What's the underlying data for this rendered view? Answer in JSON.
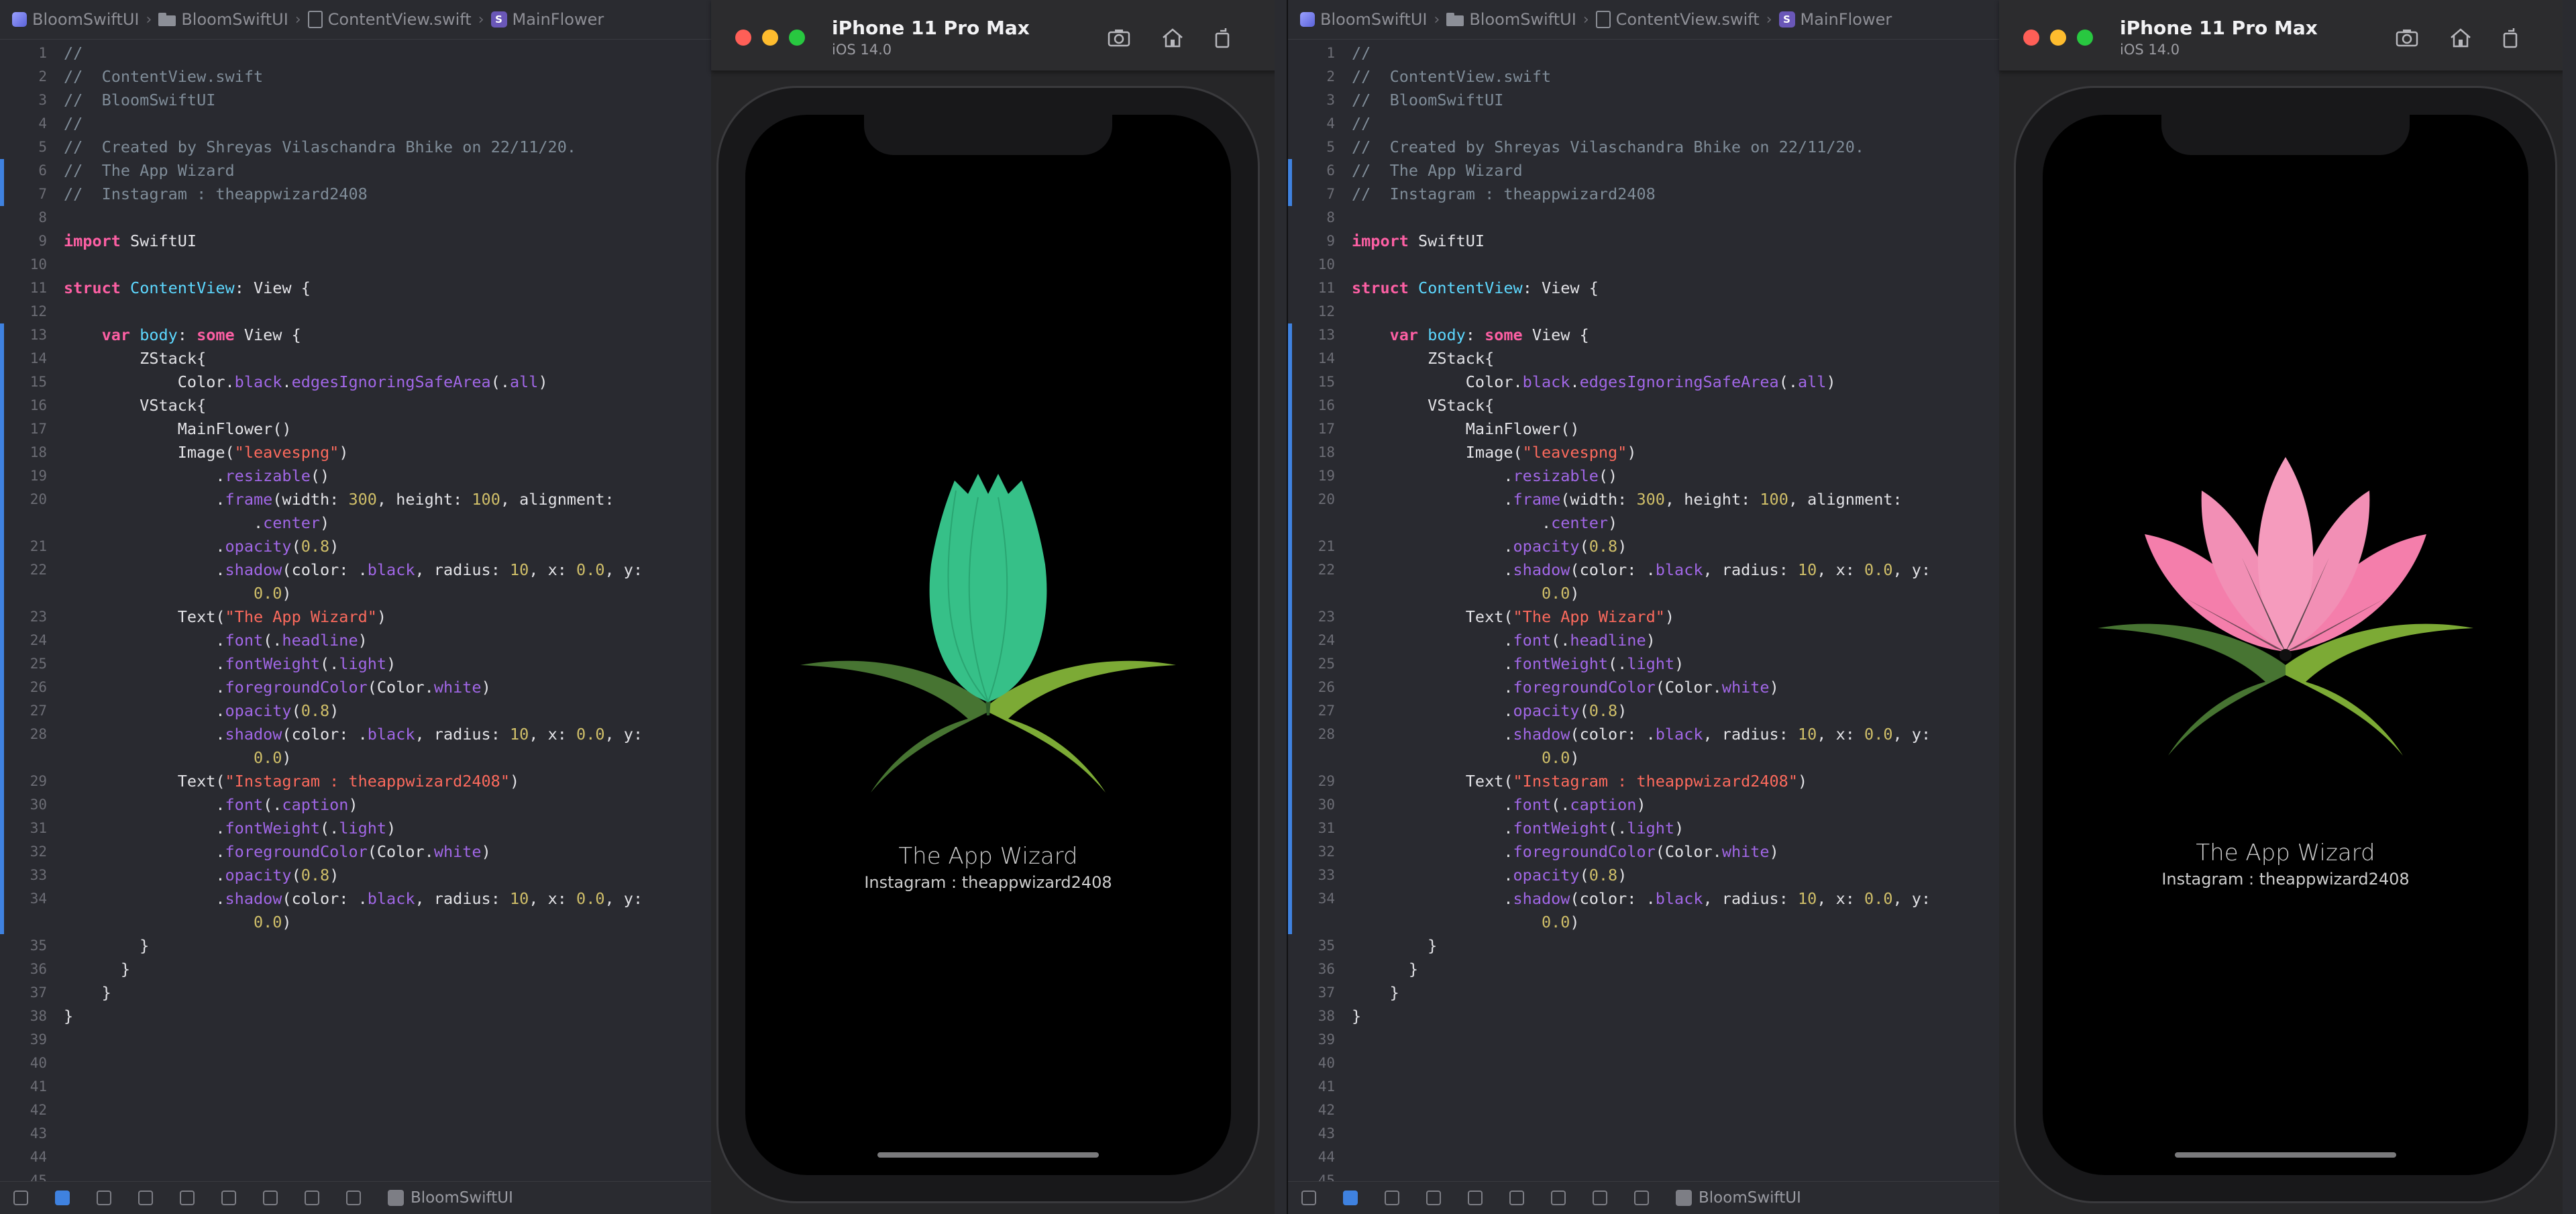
{
  "breadcrumb": [
    "BloomSwiftUI",
    "BloomSwiftUI",
    "ContentView.swift",
    "MainFlower"
  ],
  "scheme_name": "BloomSwiftUI",
  "simulator": {
    "device": "iPhone 11 Pro Max",
    "os": "iOS 14.0"
  },
  "app": {
    "title": "The App Wizard",
    "caption": "Instagram : theappwizard2408"
  },
  "code_lines": [
    {
      "n": "1",
      "t": [
        [
          "cm",
          "//"
        ]
      ]
    },
    {
      "n": "2",
      "t": [
        [
          "cm",
          "//  ContentView.swift"
        ]
      ]
    },
    {
      "n": "3",
      "t": [
        [
          "cm",
          "//  BloomSwiftUI"
        ]
      ]
    },
    {
      "n": "4",
      "t": [
        [
          "cm",
          "//"
        ]
      ]
    },
    {
      "n": "5",
      "t": [
        [
          "cm",
          "//  Created by Shreyas Vilaschandra Bhike on 22/11/20."
        ]
      ]
    },
    {
      "n": "6",
      "t": [
        [
          "cm",
          "//  The App Wizard"
        ]
      ]
    },
    {
      "n": "7",
      "t": [
        [
          "cm",
          "//  Instagram : theappwizard2408"
        ]
      ]
    },
    {
      "n": "8",
      "t": []
    },
    {
      "n": "9",
      "t": [
        [
          "kw",
          "import"
        ],
        [
          "pl",
          " SwiftUI"
        ]
      ]
    },
    {
      "n": "10",
      "t": []
    },
    {
      "n": "11",
      "t": [
        [
          "kw",
          "struct"
        ],
        [
          "pl",
          " "
        ],
        [
          "ty",
          "ContentView"
        ],
        [
          "pl",
          ": View {"
        ]
      ]
    },
    {
      "n": "12",
      "t": []
    },
    {
      "n": "13",
      "t": [
        [
          "pl",
          "    "
        ],
        [
          "kw",
          "var"
        ],
        [
          "pl",
          " "
        ],
        [
          "ty",
          "body"
        ],
        [
          "pl",
          ": "
        ],
        [
          "kw",
          "some"
        ],
        [
          "pl",
          " View {"
        ]
      ]
    },
    {
      "n": "14",
      "t": [
        [
          "pl",
          "        ZStack{"
        ]
      ]
    },
    {
      "n": "15",
      "t": [
        [
          "pl",
          "            Color."
        ],
        [
          "fn",
          "black"
        ],
        [
          "pl",
          "."
        ],
        [
          "fn",
          "edgesIgnoringSafeArea"
        ],
        [
          "pl",
          "(."
        ],
        [
          "fn",
          "all"
        ],
        [
          "pl",
          ")"
        ]
      ]
    },
    {
      "n": "16",
      "t": [
        [
          "pl",
          "        VStack{"
        ]
      ]
    },
    {
      "n": "17",
      "t": [
        [
          "pl",
          "            MainFlower()"
        ]
      ]
    },
    {
      "n": "18",
      "t": [
        [
          "pl",
          "            Image("
        ],
        [
          "st",
          "\"leavespng\""
        ],
        [
          "pl",
          ")"
        ]
      ]
    },
    {
      "n": "19",
      "t": [
        [
          "pl",
          "                ."
        ],
        [
          "fn",
          "resizable"
        ],
        [
          "pl",
          "()"
        ]
      ]
    },
    {
      "n": "20",
      "t": [
        [
          "pl",
          "                ."
        ],
        [
          "fn",
          "frame"
        ],
        [
          "pl",
          "(width: "
        ],
        [
          "nu",
          "300"
        ],
        [
          "pl",
          ", height: "
        ],
        [
          "nu",
          "100"
        ],
        [
          "pl",
          ", alignment:"
        ]
      ]
    },
    {
      "n": "",
      "t": [
        [
          "pl",
          "                    ."
        ],
        [
          "fn",
          "center"
        ],
        [
          "pl",
          ")"
        ]
      ]
    },
    {
      "n": "21",
      "t": [
        [
          "pl",
          "                ."
        ],
        [
          "fn",
          "opacity"
        ],
        [
          "pl",
          "("
        ],
        [
          "nu",
          "0.8"
        ],
        [
          "pl",
          ")"
        ]
      ]
    },
    {
      "n": "22",
      "t": [
        [
          "pl",
          "                ."
        ],
        [
          "fn",
          "shadow"
        ],
        [
          "pl",
          "(color: ."
        ],
        [
          "fn",
          "black"
        ],
        [
          "pl",
          ", radius: "
        ],
        [
          "nu",
          "10"
        ],
        [
          "pl",
          ", x: "
        ],
        [
          "nu",
          "0.0"
        ],
        [
          "pl",
          ", y:"
        ]
      ]
    },
    {
      "n": "",
      "t": [
        [
          "pl",
          "                    "
        ],
        [
          "nu",
          "0.0"
        ],
        [
          "pl",
          ")"
        ]
      ]
    },
    {
      "n": "23",
      "t": [
        [
          "pl",
          "            Text("
        ],
        [
          "st",
          "\"The App Wizard\""
        ],
        [
          "pl",
          ")"
        ]
      ]
    },
    {
      "n": "24",
      "t": [
        [
          "pl",
          "                ."
        ],
        [
          "fn",
          "font"
        ],
        [
          "pl",
          "(."
        ],
        [
          "fn",
          "headline"
        ],
        [
          "pl",
          ")"
        ]
      ]
    },
    {
      "n": "25",
      "t": [
        [
          "pl",
          "                ."
        ],
        [
          "fn",
          "fontWeight"
        ],
        [
          "pl",
          "(."
        ],
        [
          "fn",
          "light"
        ],
        [
          "pl",
          ")"
        ]
      ]
    },
    {
      "n": "26",
      "t": [
        [
          "pl",
          "                ."
        ],
        [
          "fn",
          "foregroundColor"
        ],
        [
          "pl",
          "(Color."
        ],
        [
          "fn",
          "white"
        ],
        [
          "pl",
          ")"
        ]
      ]
    },
    {
      "n": "27",
      "t": [
        [
          "pl",
          "                ."
        ],
        [
          "fn",
          "opacity"
        ],
        [
          "pl",
          "("
        ],
        [
          "nu",
          "0.8"
        ],
        [
          "pl",
          ")"
        ]
      ]
    },
    {
      "n": "28",
      "t": [
        [
          "pl",
          "                ."
        ],
        [
          "fn",
          "shadow"
        ],
        [
          "pl",
          "(color: ."
        ],
        [
          "fn",
          "black"
        ],
        [
          "pl",
          ", radius: "
        ],
        [
          "nu",
          "10"
        ],
        [
          "pl",
          ", x: "
        ],
        [
          "nu",
          "0.0"
        ],
        [
          "pl",
          ", y:"
        ]
      ]
    },
    {
      "n": "",
      "t": [
        [
          "pl",
          "                    "
        ],
        [
          "nu",
          "0.0"
        ],
        [
          "pl",
          ")"
        ]
      ]
    },
    {
      "n": "29",
      "t": [
        [
          "pl",
          "            Text("
        ],
        [
          "st",
          "\"Instagram : theappwizard2408\""
        ],
        [
          "pl",
          ")"
        ]
      ]
    },
    {
      "n": "30",
      "t": [
        [
          "pl",
          "                ."
        ],
        [
          "fn",
          "font"
        ],
        [
          "pl",
          "(."
        ],
        [
          "fn",
          "caption"
        ],
        [
          "pl",
          ")"
        ]
      ]
    },
    {
      "n": "31",
      "t": [
        [
          "pl",
          "                ."
        ],
        [
          "fn",
          "fontWeight"
        ],
        [
          "pl",
          "(."
        ],
        [
          "fn",
          "light"
        ],
        [
          "pl",
          ")"
        ]
      ]
    },
    {
      "n": "32",
      "t": [
        [
          "pl",
          "                ."
        ],
        [
          "fn",
          "foregroundColor"
        ],
        [
          "pl",
          "(Color."
        ],
        [
          "fn",
          "white"
        ],
        [
          "pl",
          ")"
        ]
      ]
    },
    {
      "n": "33",
      "t": [
        [
          "pl",
          "                ."
        ],
        [
          "fn",
          "opacity"
        ],
        [
          "pl",
          "("
        ],
        [
          "nu",
          "0.8"
        ],
        [
          "pl",
          ")"
        ]
      ]
    },
    {
      "n": "34",
      "t": [
        [
          "pl",
          "                ."
        ],
        [
          "fn",
          "shadow"
        ],
        [
          "pl",
          "(color: ."
        ],
        [
          "fn",
          "black"
        ],
        [
          "pl",
          ", radius: "
        ],
        [
          "nu",
          "10"
        ],
        [
          "pl",
          ", x: "
        ],
        [
          "nu",
          "0.0"
        ],
        [
          "pl",
          ", y:"
        ]
      ]
    },
    {
      "n": "",
      "t": [
        [
          "pl",
          "                    "
        ],
        [
          "nu",
          "0.0"
        ],
        [
          "pl",
          ")"
        ]
      ]
    },
    {
      "n": "35",
      "t": [
        [
          "pl",
          "        }"
        ]
      ]
    },
    {
      "n": "36",
      "t": [
        [
          "pl",
          "      }"
        ]
      ]
    },
    {
      "n": "37",
      "t": [
        [
          "pl",
          "    }"
        ]
      ]
    },
    {
      "n": "38",
      "t": [
        [
          "pl",
          "}"
        ]
      ]
    },
    {
      "n": "39",
      "t": []
    },
    {
      "n": "40",
      "t": []
    },
    {
      "n": "41",
      "t": []
    },
    {
      "n": "42",
      "t": []
    },
    {
      "n": "43",
      "t": []
    },
    {
      "n": "44",
      "t": []
    },
    {
      "n": "45",
      "t": []
    }
  ],
  "colors": {
    "bud_green": "#36c088",
    "petal_pink": "#f47eab",
    "leaf_green": "#6e9e33",
    "accent_blue": "#3f82e0"
  }
}
